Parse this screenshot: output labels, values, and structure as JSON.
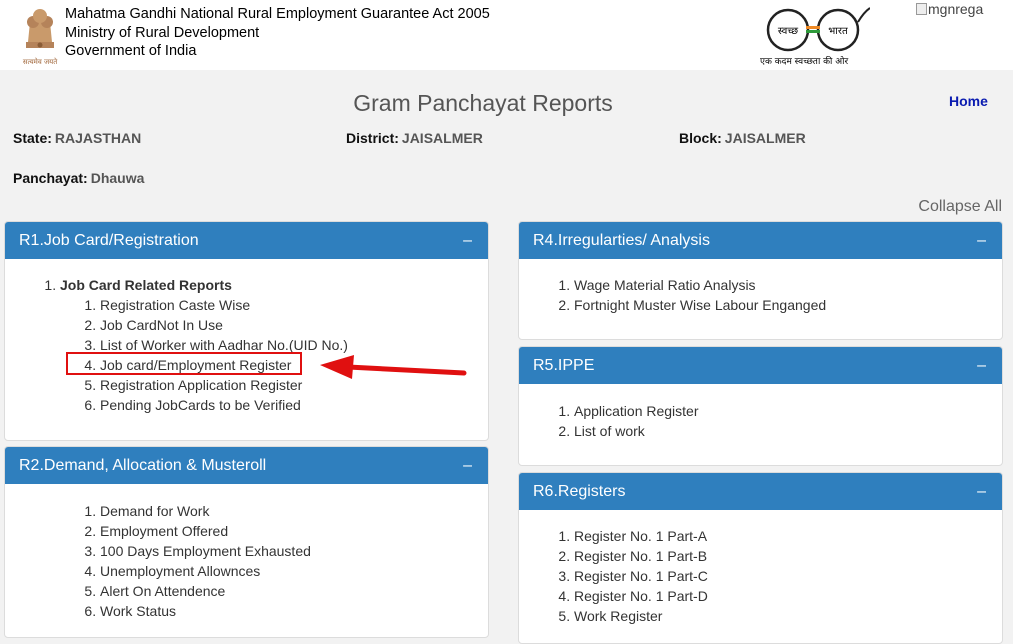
{
  "header": {
    "org_line1": "Mahatma Gandhi National Rural Employment Guarantee Act 2005",
    "org_line2": "Ministry of Rural Development",
    "org_line3": "Government of India",
    "emblem_caption": "सत्यमेव जयते",
    "swachh_left": "स्वच्छ",
    "swachh_right": "भारत",
    "swachh_tagline": "एक कदम स्वच्छता की ओर",
    "logo_alt": "mgnrega"
  },
  "page": {
    "title": "Gram Panchayat Reports",
    "home_label": "Home",
    "collapse_all_label": "Collapse All"
  },
  "location": {
    "state_label": "State:",
    "state_value": "RAJASTHAN",
    "district_label": "District:",
    "district_value": "JAISALMER",
    "block_label": "Block:",
    "block_value": "JAISALMER",
    "panchayat_label": "Panchayat:",
    "panchayat_value": "Dhauwa"
  },
  "panels": {
    "r1": {
      "title": "R1.Job Card/Registration",
      "toggle": "–",
      "group": "Job Card Related Reports",
      "items": [
        "Registration Caste Wise",
        "Job CardNot In Use",
        "List of Worker with Aadhar No.(UID No.)",
        "Job card/Employment Register",
        "Registration Application Register",
        "Pending JobCards to be Verified"
      ]
    },
    "r2": {
      "title": "R2.Demand, Allocation & Musteroll",
      "toggle": "–",
      "items": [
        "Demand for Work",
        "Employment Offered",
        "100 Days Employment Exhausted",
        "Unemployment Allownces",
        "Alert On Attendence",
        "Work Status"
      ]
    },
    "r4": {
      "title": "R4.Irregularties/ Analysis",
      "toggle": "–",
      "items": [
        "Wage Material Ratio Analysis",
        "Fortnight Muster Wise Labour Enganged"
      ]
    },
    "r5": {
      "title": "R5.IPPE",
      "toggle": "–",
      "items": [
        "Application Register",
        "List of work"
      ]
    },
    "r6": {
      "title": "R6.Registers",
      "toggle": "–",
      "items": [
        "Register No. 1 Part-A",
        "Register No. 1 Part-B",
        "Register No. 1 Part-C",
        "Register No. 1 Part-D",
        "Work Register"
      ]
    }
  },
  "colors": {
    "panel_header": "#2f7fbe",
    "highlight": "#e01010",
    "home_link": "#0a1bb0"
  }
}
